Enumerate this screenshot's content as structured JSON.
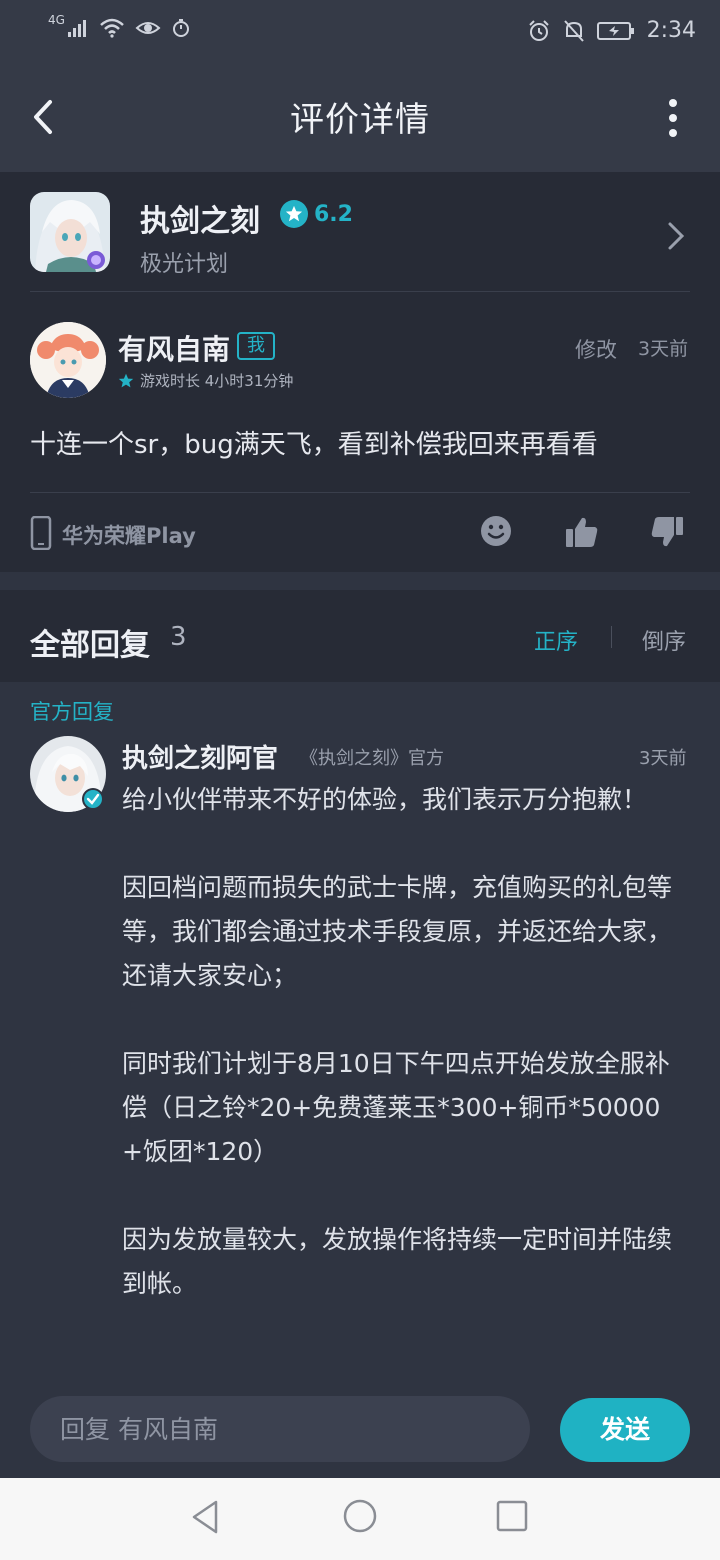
{
  "status_bar": {
    "network": "4G",
    "time": "2:34",
    "icons": [
      "signal-icon",
      "wifi-icon",
      "eye-icon",
      "timer-icon",
      "alarm-icon",
      "mute-icon",
      "battery-icon"
    ]
  },
  "header": {
    "title": "评价详情"
  },
  "game": {
    "name": "执剑之刻",
    "rating": "6.2",
    "developer": "极光计划"
  },
  "review": {
    "author": "有风自南",
    "me_badge": "我",
    "playtime": "游戏时长 4小时31分钟",
    "edit_label": "修改",
    "time": "3天前",
    "text": "十连一个sr，bug满天飞，看到补偿我回来再看看",
    "source": "华为荣耀Play"
  },
  "replies": {
    "title": "全部回复",
    "count": "3",
    "sort_asc": "正序",
    "sort_desc": "倒序",
    "official_label": "官方回复",
    "items": [
      {
        "author": "执剑之刻阿官",
        "tag": "《执剑之刻》官方",
        "time": "3天前",
        "body": "给小伙伴带来不好的体验，我们表示万分抱歉！\n\n因回档问题而损失的武士卡牌，充值购买的礼包等等，我们都会通过技术手段复原，并返还给大家，还请大家安心；\n\n同时我们计划于8月10日下午四点开始发放全服补偿（日之铃*20+免费蓬莱玉*300+铜币*50000+饭团*120）\n\n因为发放量较大，发放操作将持续一定时间并陆续到帐。"
      }
    ]
  },
  "composer": {
    "placeholder": "回复 有风自南",
    "send_label": "发送"
  },
  "colors": {
    "accent": "#24b3c7",
    "background": "#2f3441",
    "card": "#272b36"
  }
}
